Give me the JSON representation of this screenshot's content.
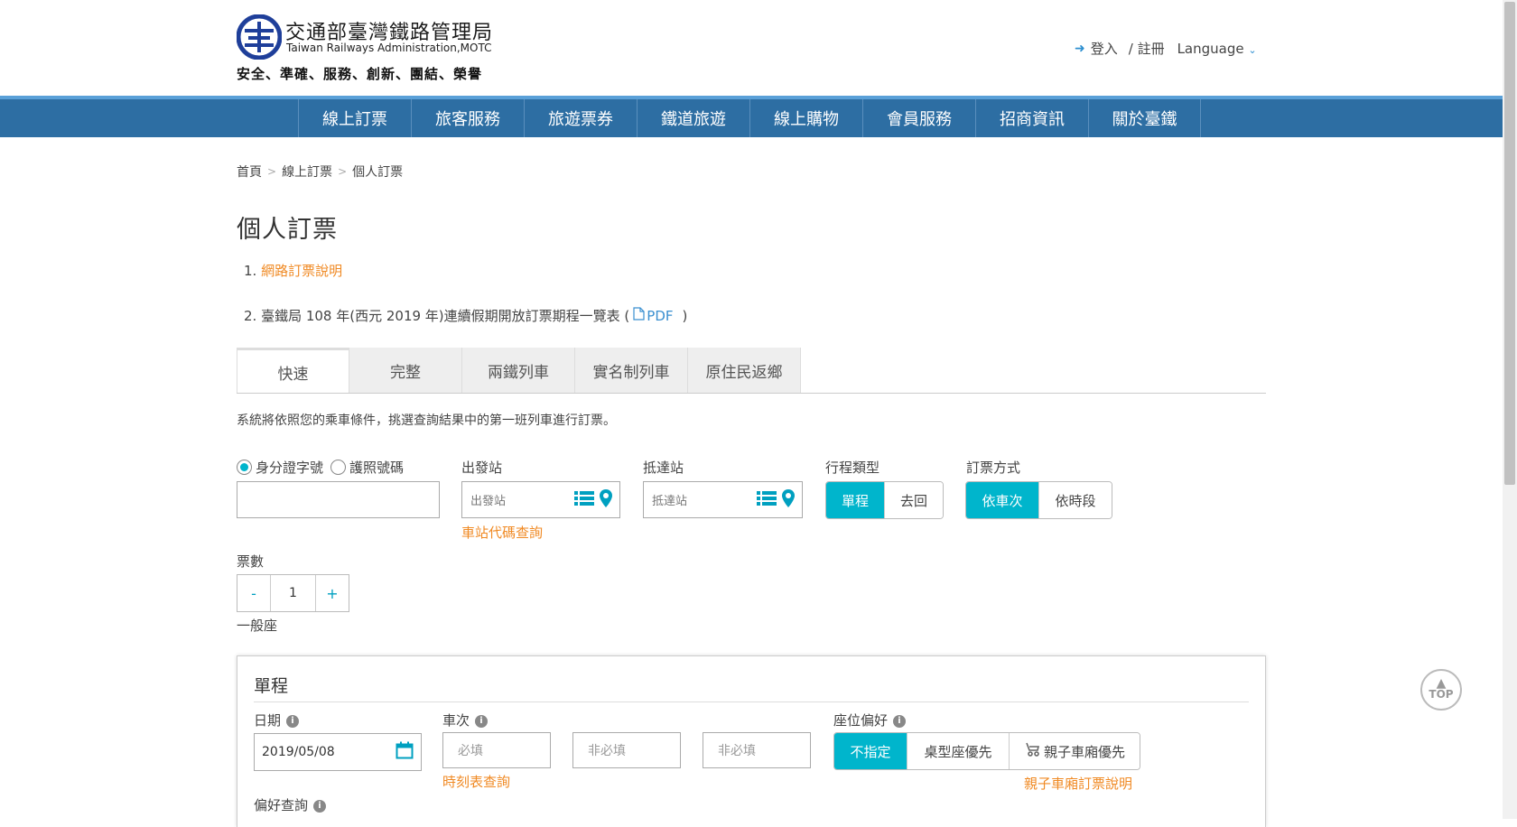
{
  "header": {
    "brand_zh": "交通部臺灣鐵路管理局",
    "brand_en": "Taiwan Railways Administration,MOTC",
    "slogan": "安全、準確、服務、創新、團結、榮譽",
    "login_label": "登入",
    "register_label": "/ 註冊",
    "language_label": "Language"
  },
  "nav": {
    "items": [
      "線上訂票",
      "旅客服務",
      "旅遊票券",
      "鐵道旅遊",
      "線上購物",
      "會員服務",
      "招商資訊",
      "關於臺鐵"
    ]
  },
  "breadcrumb": {
    "items": [
      "首頁",
      "線上訂票",
      "個人訂票"
    ],
    "separator": ">"
  },
  "page_title": "個人訂票",
  "notices": {
    "n1_prefix": "1. ",
    "n1_link": "網路訂票說明",
    "n2_prefix": "2. 臺鐵局 108 年(西元 2019 年)連續假期開放訂票期程一覽表 (",
    "n2_pdf": "PDF",
    "n2_suffix": ")"
  },
  "tabs": [
    "快速",
    "完整",
    "兩鐵列車",
    "實名制列車",
    "原住民返鄉"
  ],
  "description": "系統將依照您的乘車條件，挑選查詢結果中的第一班列車進行訂票。",
  "form": {
    "id_option": "身分證字號",
    "passport_option": "護照號碼",
    "depart_label": "出發站",
    "depart_placeholder": "出發站",
    "station_code_link": "車站代碼查詢",
    "arrive_label": "抵達站",
    "arrive_placeholder": "抵達站",
    "trip_type_label": "行程類型",
    "trip_oneway": "單程",
    "trip_return": "去回",
    "order_method_label": "訂票方式",
    "order_by_train": "依車次",
    "order_by_time": "依時段",
    "ticket_count_label": "票數",
    "ticket_minus": "-",
    "ticket_count": "1",
    "ticket_plus": "+",
    "seat_class": "一般座"
  },
  "panel": {
    "title": "單程",
    "date_label": "日期",
    "date_value": "2019/05/08",
    "train_no_label": "車次",
    "train_no_placeholder_1": "必填",
    "train_no_placeholder_2": "非必填",
    "train_no_placeholder_3": "非必填",
    "timetable_link": "時刻表查詢",
    "seat_pref_label": "座位偏好",
    "seat_any": "不指定",
    "seat_table": "桌型座優先",
    "seat_family": "親子車廂優先",
    "family_link": "親子車廂訂票說明",
    "pref_query_label": "偏好查詢"
  },
  "top_button": "TOP",
  "colors": {
    "nav_bg": "#2d6ea3",
    "accent": "#00b5cc",
    "link_orange": "#f08a24"
  }
}
